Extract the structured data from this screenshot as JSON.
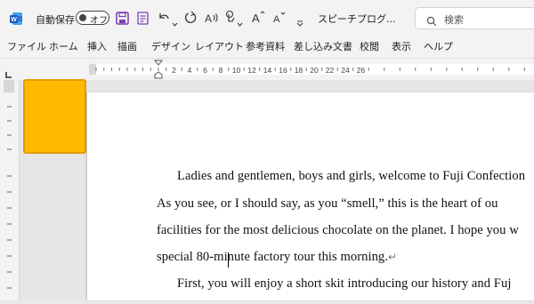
{
  "titlebar": {
    "autosave_label": "自動保存",
    "autosave_toggle": "オフ",
    "doc_title": "スピーチプログ...",
    "search_placeholder": "検索"
  },
  "ribbon": {
    "tabs": [
      "ファイル",
      "ホーム",
      "挿入",
      "描画",
      "デザイン",
      "レイアウト",
      "参考資料",
      "差し込み文書",
      "校閲",
      "表示",
      "ヘルプ"
    ]
  },
  "ruler": {
    "labels": [
      "2",
      "4",
      "6",
      "8",
      "10",
      "12",
      "14",
      "16",
      "18",
      "20",
      "22",
      "24",
      "26"
    ]
  },
  "document": {
    "lines": [
      "Ladies and gentlemen, boys and girls, welcome to Fuji Confection",
      "As you see, or I should say, as you “smell,” this is the heart of ou",
      "facilities for the most delicious chocolate on the planet. I hope you w",
      "special 80-minute factory tour this morning.",
      "First, you will enjoy a short skit introducing our history and Fuj"
    ],
    "paragraph_mark": "↵"
  },
  "colors": {
    "word_blue": "#185abd",
    "save_purple": "#7a3db8",
    "shape_fill": "#ffb900",
    "shape_border": "#e59a00"
  }
}
